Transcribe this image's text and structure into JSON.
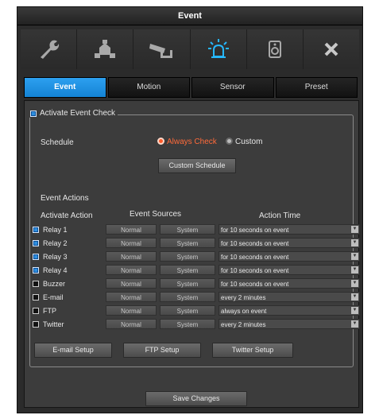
{
  "window": {
    "title": "Event"
  },
  "toolbar_icons": [
    "wrench-icon",
    "network-icon",
    "camera-icon",
    "alarm-icon",
    "speaker-icon",
    "close-icon"
  ],
  "colors": {
    "accent": "#1e90e8",
    "radio_on": "#ff5a2a",
    "background": "#2b2b2b"
  },
  "tabs": [
    {
      "label": "Event",
      "active": true
    },
    {
      "label": "Motion",
      "active": false
    },
    {
      "label": "Sensor",
      "active": false
    },
    {
      "label": "Preset",
      "active": false
    }
  ],
  "activate": {
    "label": "Activate Event Check",
    "checked": true
  },
  "schedule": {
    "label": "Schedule",
    "always_label": "Always Check",
    "custom_label": "Custom",
    "selected": "Always Check",
    "custom_button": "Custom Schedule"
  },
  "event_actions": {
    "label": "Event Actions",
    "headers": {
      "action": "Activate Action",
      "sources": "Event Sources",
      "time": "Action Time"
    },
    "rows": [
      {
        "name": "Relay 1",
        "checked": true,
        "normal": "Normal",
        "system": "System",
        "time": "for 10 seconds on event"
      },
      {
        "name": "Relay 2",
        "checked": true,
        "normal": "Normal",
        "system": "System",
        "time": "for 10 seconds on event"
      },
      {
        "name": "Relay 3",
        "checked": true,
        "normal": "Normal",
        "system": "System",
        "time": "for 10 seconds on event"
      },
      {
        "name": "Relay 4",
        "checked": true,
        "normal": "Normal",
        "system": "System",
        "time": "for 10 seconds on event"
      },
      {
        "name": "Buzzer",
        "checked": false,
        "normal": "Normal",
        "system": "System",
        "time": "for 10 seconds on event"
      },
      {
        "name": "E-mail",
        "checked": false,
        "normal": "Normal",
        "system": "System",
        "time": "every 2 minutes"
      },
      {
        "name": "FTP",
        "checked": false,
        "normal": "Normal",
        "system": "System",
        "time": "always on event"
      },
      {
        "name": "Twitter",
        "checked": false,
        "normal": "Normal",
        "system": "System",
        "time": "every 2 minutes"
      }
    ]
  },
  "setup_buttons": {
    "email": "E-mail Setup",
    "ftp": "FTP Setup",
    "twitter": "Twitter Setup"
  },
  "save_button": "Save Changes"
}
